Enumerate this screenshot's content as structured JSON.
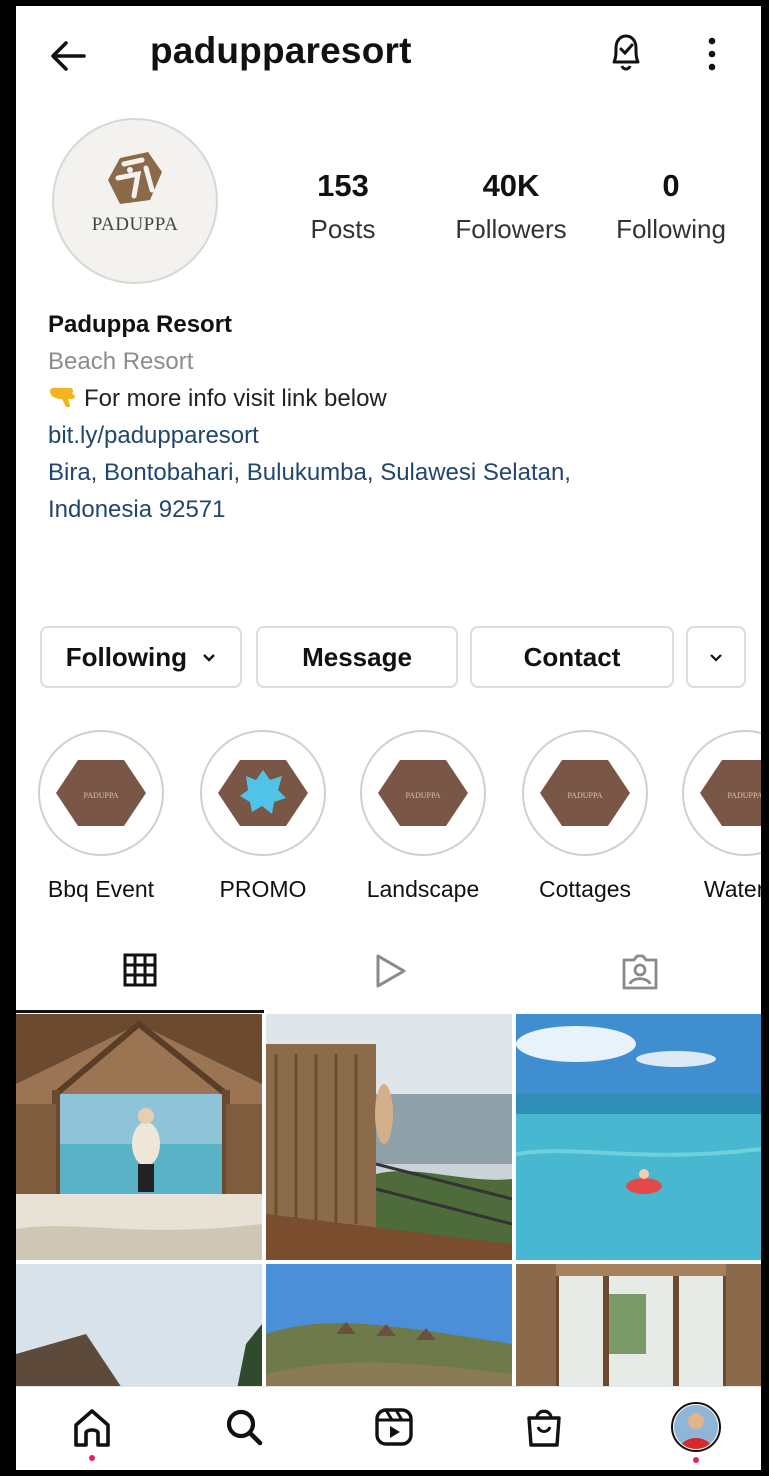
{
  "header": {
    "username": "padupparesort"
  },
  "profile": {
    "avatar_text": "PADUPPA",
    "stats": [
      {
        "value": "153",
        "label": "Posts"
      },
      {
        "value": "40K",
        "label": "Followers"
      },
      {
        "value": "0",
        "label": "Following"
      }
    ],
    "name": "Paduppa Resort",
    "category": "Beach Resort",
    "bio_line": "For more info visit link below",
    "link": "bit.ly/padupparesort",
    "address_line1": "Bira, Bontobahari, Bulukumba, Sulawesi Selatan,",
    "address_line2": "Indonesia 92571"
  },
  "actions": {
    "following": "Following",
    "message": "Message",
    "contact": "Contact"
  },
  "highlights": [
    {
      "label": "Bbq Event"
    },
    {
      "label": "PROMO"
    },
    {
      "label": "Landscape"
    },
    {
      "label": "Cottages"
    },
    {
      "label": "Water S"
    }
  ],
  "tabs": [
    "grid-icon",
    "reels-icon",
    "tagged-icon"
  ],
  "nav": [
    "home-icon",
    "search-icon",
    "reels-icon",
    "shop-icon",
    "profile-avatar"
  ],
  "colors": {
    "link": "#22466e",
    "hexagon": "#7a5646",
    "notification_dot": "#e0245e"
  }
}
